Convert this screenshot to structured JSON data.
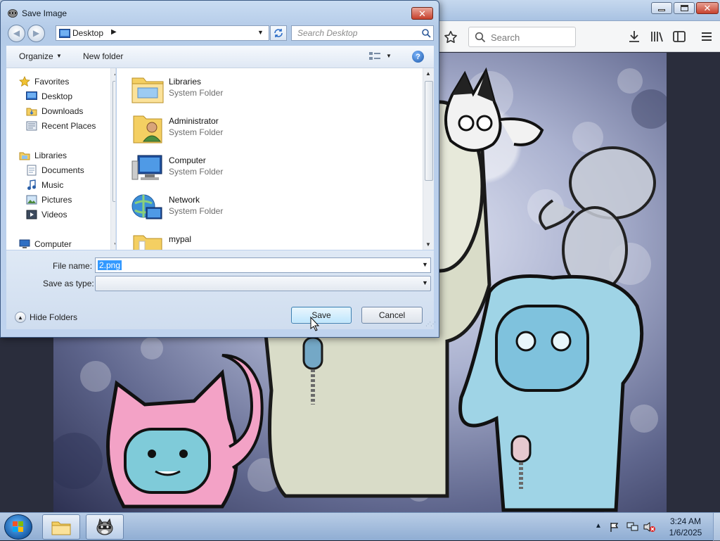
{
  "browser": {
    "search_placeholder": "Search"
  },
  "dialog": {
    "title": "Save Image",
    "address": "Desktop",
    "search_placeholder": "Search Desktop",
    "toolbar": {
      "organize_label": "Organize",
      "new_folder_label": "New folder"
    },
    "nav_pane": {
      "favorites": {
        "label": "Favorites",
        "items": [
          "Desktop",
          "Downloads",
          "Recent Places"
        ]
      },
      "libraries": {
        "label": "Libraries",
        "items": [
          "Documents",
          "Music",
          "Pictures",
          "Videos"
        ]
      },
      "computer_label": "Computer"
    },
    "files": [
      {
        "name": "Libraries",
        "type": "System Folder",
        "icon": "libraries-folder-icon"
      },
      {
        "name": "Administrator",
        "type": "System Folder",
        "icon": "user-folder-icon"
      },
      {
        "name": "Computer",
        "type": "System Folder",
        "icon": "computer-icon"
      },
      {
        "name": "Network",
        "type": "System Folder",
        "icon": "network-icon"
      },
      {
        "name": "mypal",
        "type": "",
        "icon": "folder-icon"
      }
    ],
    "file_name_label": "File name:",
    "file_name_value": "2.png",
    "save_as_type_label": "Save as type:",
    "save_as_type_value": "",
    "hide_folders_label": "Hide Folders",
    "save_label": "Save",
    "cancel_label": "Cancel"
  },
  "taskbar": {
    "time": "3:24 AM",
    "date": "1/6/2025"
  },
  "colors": {
    "selection": "#3399ff",
    "close_red": "#c6402c",
    "taskbar": "#a4bedf"
  }
}
